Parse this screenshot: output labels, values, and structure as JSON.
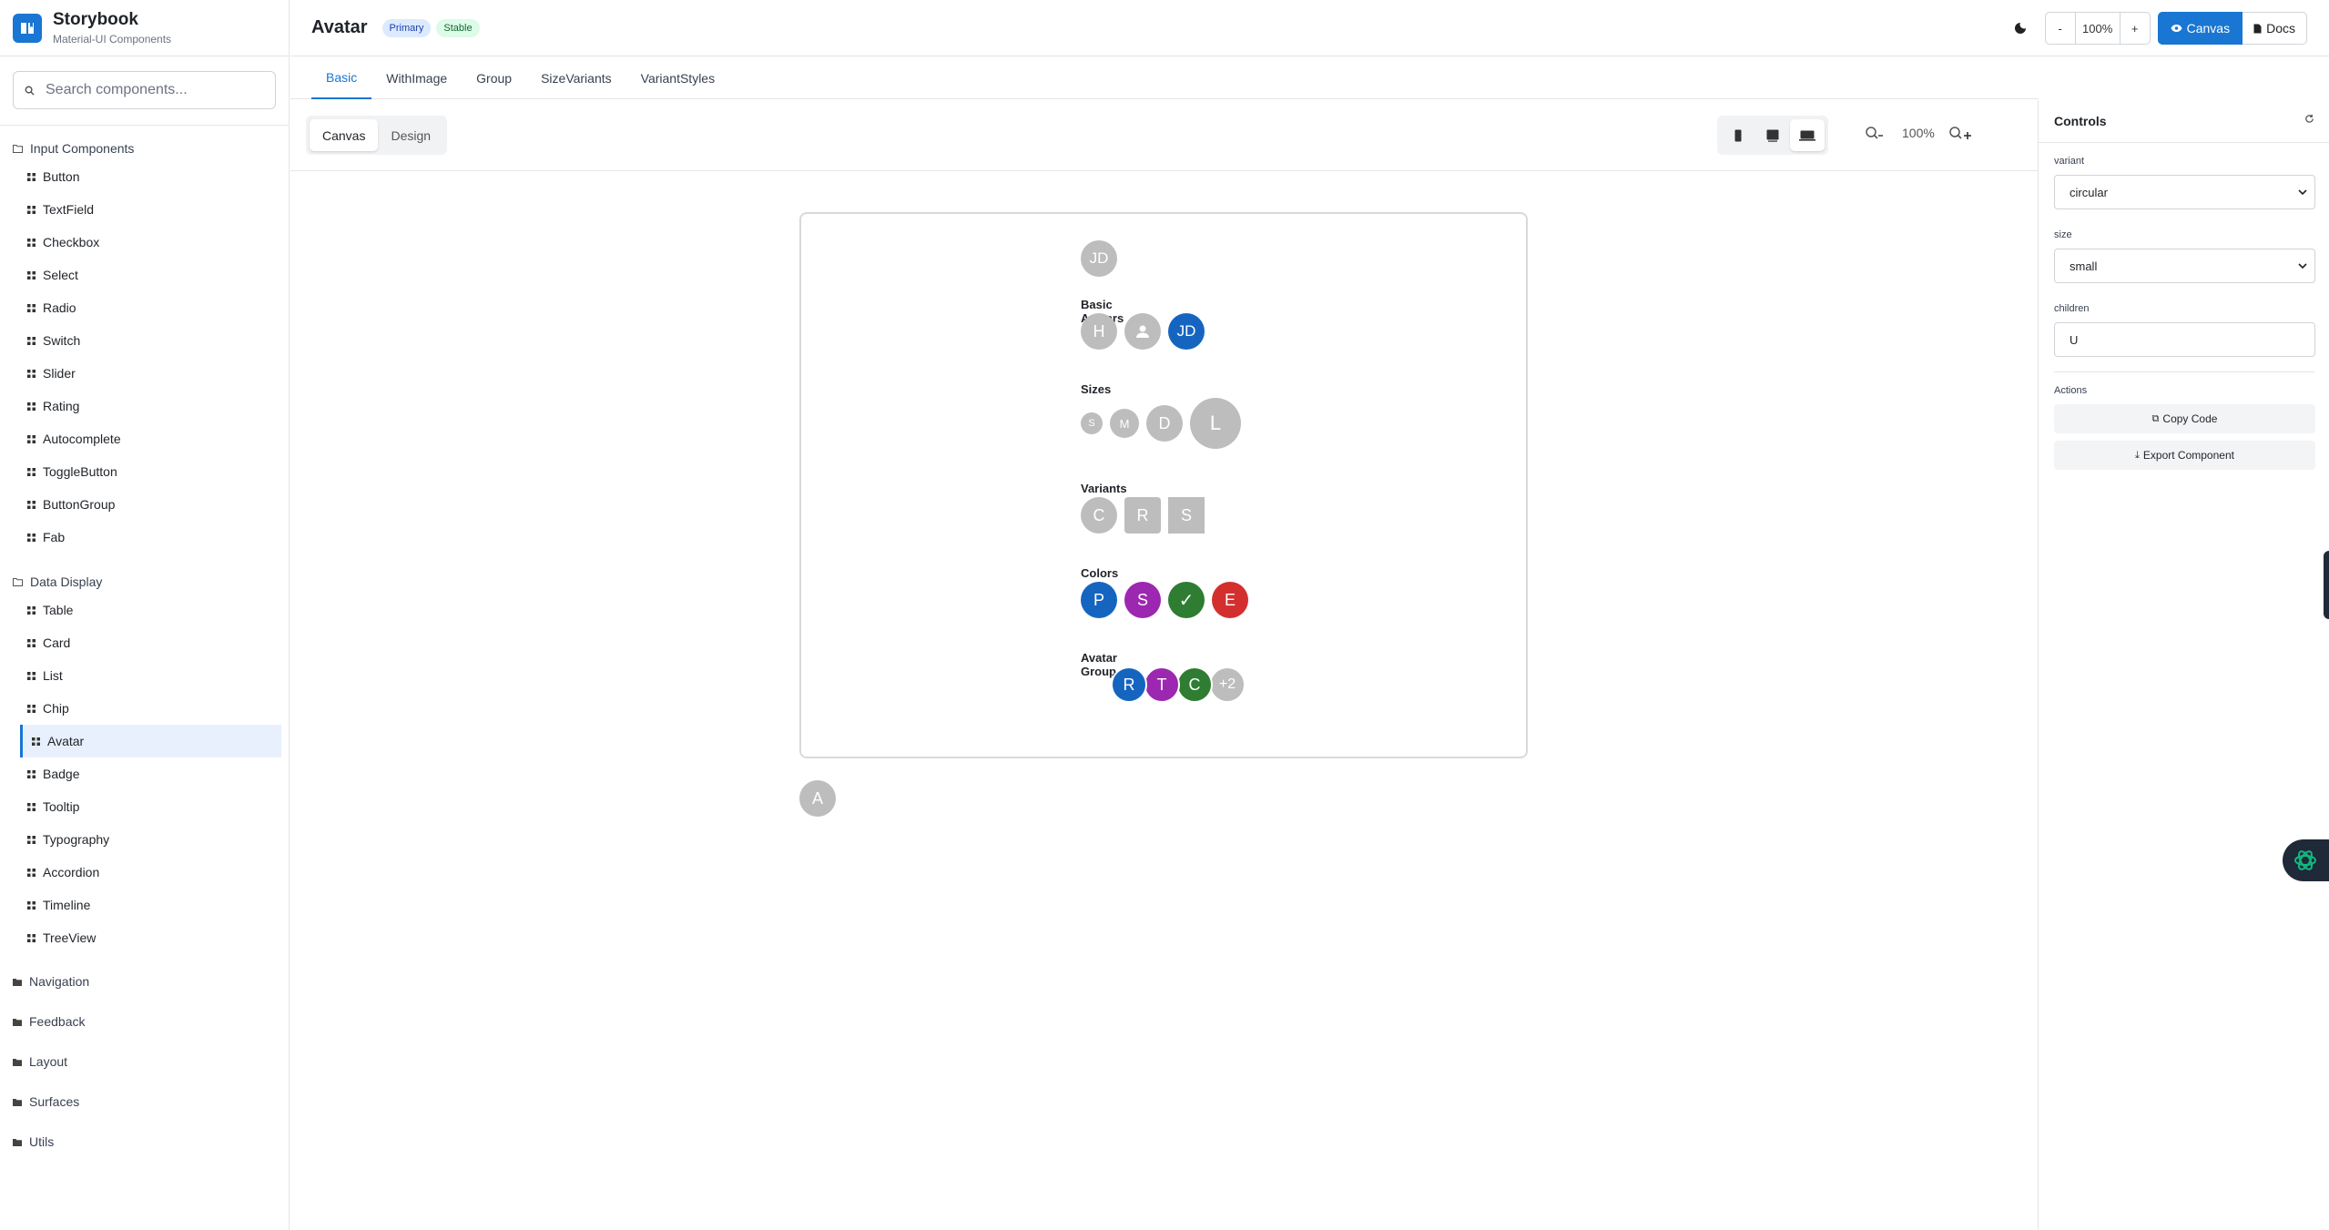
{
  "brand": {
    "title": "Storybook",
    "subtitle": "Material-UI Components"
  },
  "search": {
    "placeholder": "Search components..."
  },
  "sidebar": {
    "input_category": "Input Components",
    "input_items": [
      "Button",
      "TextField",
      "Checkbox",
      "Select",
      "Radio",
      "Switch",
      "Slider",
      "Rating",
      "Autocomplete",
      "ToggleButton",
      "ButtonGroup",
      "Fab"
    ],
    "display_category": "Data Display",
    "display_items": [
      "Table",
      "Card",
      "List",
      "Chip",
      "Avatar",
      "Badge",
      "Tooltip",
      "Typography",
      "Accordion",
      "Timeline",
      "TreeView"
    ],
    "active_item": "Avatar",
    "collapsed_categories": [
      "Navigation",
      "Feedback",
      "Layout",
      "Surfaces",
      "Utils"
    ]
  },
  "header": {
    "title": "Avatar",
    "badges": [
      "Primary",
      "Stable"
    ],
    "zoom_minus": "-",
    "zoom_value": "100%",
    "zoom_plus": "+",
    "canvas_label": "Canvas",
    "docs_label": "Docs"
  },
  "tabs": [
    "Basic",
    "WithImage",
    "Group",
    "SizeVariants",
    "VariantStyles"
  ],
  "active_tab": "Basic",
  "toolbar": {
    "modes": [
      "Canvas",
      "Design"
    ],
    "active_mode": "Canvas",
    "zoom_value": "100%",
    "devices": [
      "mobile-icon",
      "tablet-icon",
      "desktop-icon"
    ],
    "active_device": "desktop-icon"
  },
  "preview": {
    "top_avatar": "JD",
    "sections": {
      "basic": {
        "label": "Basic Avatars",
        "avatars": [
          "H",
          "",
          "JD"
        ]
      },
      "sizes": {
        "label": "Sizes",
        "avatars": [
          "S",
          "M",
          "D",
          "L"
        ]
      },
      "variants": {
        "label": "Variants",
        "avatars": [
          "C",
          "R",
          "S"
        ]
      },
      "colors": {
        "label": "Colors",
        "avatars": [
          "P",
          "S",
          "✓",
          "E"
        ]
      },
      "group": {
        "label": "Avatar Group",
        "avatars": [
          "R",
          "T",
          "C",
          "+2"
        ]
      }
    },
    "outside_avatar": "A"
  },
  "controls": {
    "title": "Controls",
    "variant_label": "variant",
    "variant_value": "circular",
    "size_label": "size",
    "size_value": "small",
    "children_label": "children",
    "children_value": "U",
    "actions_label": "Actions",
    "copy_label": "Copy Code",
    "export_label": "Export Component"
  },
  "colors": {
    "accent": "#1976d2",
    "avatar_default": "#bdbdbd",
    "primary": "#1565c0",
    "secondary": "#9c27b0",
    "success": "#2e7d32",
    "error": "#d32f2f"
  }
}
